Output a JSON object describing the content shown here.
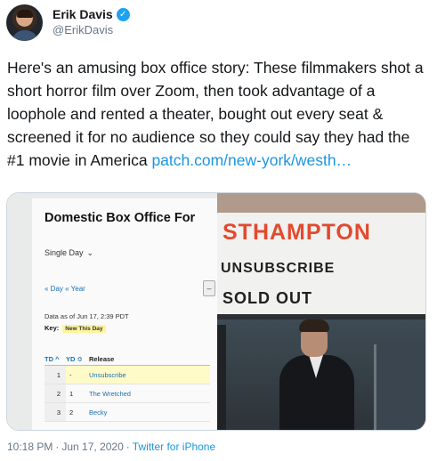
{
  "author": {
    "display_name": "Erik Davis",
    "handle": "@ErikDavis",
    "verified_icon": "verified-badge-icon"
  },
  "tweet": {
    "text": "Here's an amusing box office story: These filmmakers shot a short horror film over Zoom, then took advantage of a loophole and rented a theater, bought out every seat & screened it for no audience so they could say they had the #1 movie in America",
    "link": "patch.com/new-york/westh…"
  },
  "media": {
    "box_office": {
      "title": "Domestic Box Office For",
      "period_select": "Single Day",
      "nav": "« Day « Year",
      "data_as_of": "Data as of Jun 17, 2:39 PDT",
      "key_label": "Key:",
      "key_chip": "New This Day",
      "columns": [
        "TD ^",
        "YD ≎",
        "Release"
      ],
      "rows": [
        {
          "td": "1",
          "yd": "-",
          "release": "Unsubscribe",
          "new": true
        },
        {
          "td": "2",
          "yd": "1",
          "release": "The Wretched",
          "new": false
        },
        {
          "td": "3",
          "yd": "2",
          "release": "Becky",
          "new": false
        }
      ]
    },
    "marquee": {
      "line1": "STHAMPTON",
      "line2": "UNSUBSCRIBE",
      "line3": "SOLD OUT"
    }
  },
  "footer": {
    "time": "10:18 PM",
    "date": "Jun 17, 2020",
    "separator": "·",
    "source": "Twitter for iPhone"
  }
}
